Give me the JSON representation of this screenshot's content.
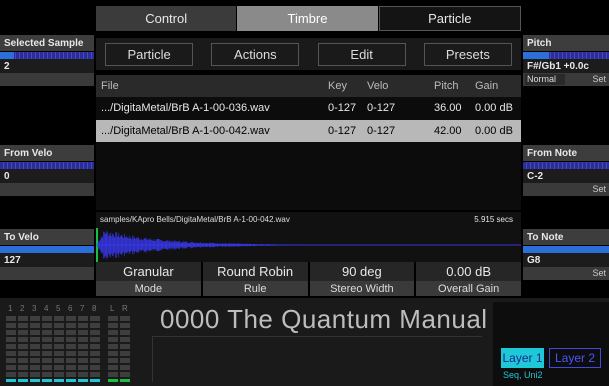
{
  "top_tabs": [
    "Control",
    "Timbre",
    "Particle"
  ],
  "sub_tabs": [
    "Particle",
    "Actions",
    "Edit",
    "Presets"
  ],
  "left_panel": {
    "selected_sample": {
      "label": "Selected Sample",
      "value": "2",
      "bar_fraction": 0.15
    },
    "from_velo": {
      "label": "From Velo",
      "value": "0",
      "bar_fraction": 0.0
    },
    "to_velo": {
      "label": "To Velo",
      "value": "127",
      "bar_fraction": 1.0
    }
  },
  "right_panel": {
    "pitch": {
      "label": "Pitch",
      "value": "F#/Gb1 +0.0c",
      "mode": "Normal",
      "set": "Set",
      "bar_fraction": 0.3
    },
    "from_note": {
      "label": "From Note",
      "value": "C-2",
      "set": "Set",
      "bar_fraction": 0.0
    },
    "to_note": {
      "label": "To Note",
      "value": "G8",
      "set": "Set",
      "bar_fraction": 1.0
    }
  },
  "file_table": {
    "headers": {
      "file": "File",
      "key": "Key",
      "velo": "Velo",
      "pitch": "Pitch",
      "gain": "Gain"
    },
    "rows": [
      {
        "file": ".../DigitaMetal/BrB A-1-00-036.wav",
        "key": "0-127",
        "velo": "0-127",
        "pitch": "36.00",
        "gain": "0.00 dB",
        "selected": false
      },
      {
        "file": ".../DigitaMetal/BrB A-1-00-042.wav",
        "key": "0-127",
        "velo": "0-127",
        "pitch": "42.00",
        "gain": "0.00 dB",
        "selected": true
      }
    ]
  },
  "waveform": {
    "path": "samples/KApro Bells/DigitaMetal/BrB A-1-00-042.wav",
    "duration": "5.915 secs",
    "color": "#3b3bff",
    "marker_color": "#18c040"
  },
  "params": [
    {
      "value": "Granular",
      "name": "Mode"
    },
    {
      "value": "Round Robin",
      "name": "Rule"
    },
    {
      "value": "90 deg",
      "name": "Stereo Width"
    },
    {
      "value": "0.00 dB",
      "name": "Overall Gain"
    }
  ],
  "footer": {
    "meter_labels": [
      "1",
      "2",
      "3",
      "4",
      "5",
      "6",
      "7",
      "8",
      "L",
      "R"
    ],
    "meter_led_colors": [
      "#1ec8d6",
      "#1ec8d6",
      "#1ec8d6",
      "#1ec8d6",
      "#1ec8d6",
      "#1ec8d6",
      "#1ec8d6",
      "#1ec8d6",
      "#18c040",
      "#18c040"
    ],
    "patch_name": "0000 The Quantum Manual",
    "layer1": "Layer 1",
    "layer2": "Layer 2",
    "layer_seq": "Seq, Uni2"
  },
  "colors": {
    "accent": "#1ec8d6",
    "bar": "#2a2d9a",
    "selected_row": "#b8b8b8"
  }
}
